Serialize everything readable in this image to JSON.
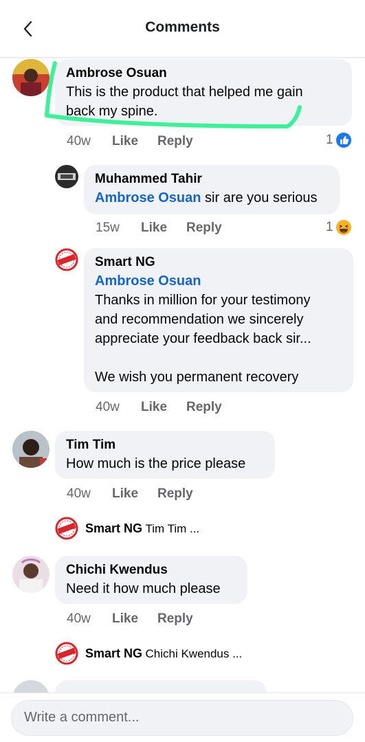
{
  "header": {
    "title": "Comments"
  },
  "comments": [
    {
      "author": "Ambrose Osuan",
      "text_line1": "This is the product that helped me gain",
      "text_line2": "back my spine.",
      "time": "40w",
      "like": "Like",
      "reply": "Reply",
      "reaction_count": "1",
      "reaction_icon": "like-icon"
    },
    {
      "author": "Muhammed Tahir",
      "mention": "Ambrose Osuan",
      "text": " sir are you serious",
      "time": "15w",
      "like": "Like",
      "reply": "Reply",
      "reaction_count": "1",
      "reaction_icon": "haha-icon"
    },
    {
      "author": "Smart NG",
      "mention": "Ambrose Osuan",
      "line1": "Thanks in million for your testimony",
      "line2": "and recommendation we sincerely",
      "line3": "appreciate your feedback back sir...",
      "line4": "We wish you permanent recovery",
      "time": "40w",
      "like": "Like",
      "reply": "Reply"
    },
    {
      "author": "Tim Tim",
      "text": "How much is the price please",
      "time": "40w",
      "like": "Like",
      "reply": "Reply",
      "reply_preview": {
        "author": "Smart NG",
        "text": "Tim Tim ..."
      }
    },
    {
      "author": "Chichi Kwendus",
      "text": "Need it how much please",
      "time": "40w",
      "like": "Like",
      "reply": "Reply",
      "reply_preview": {
        "author": "Smart NG",
        "text": "Chichi Kwendus ..."
      }
    }
  ],
  "composer": {
    "placeholder": "Write a comment..."
  },
  "colors": {
    "mention": "#1566c4",
    "bubble": "#f0f2f5",
    "meta": "#65676b",
    "highlight": "#3ef09a",
    "brand_red": "#d8262c"
  }
}
